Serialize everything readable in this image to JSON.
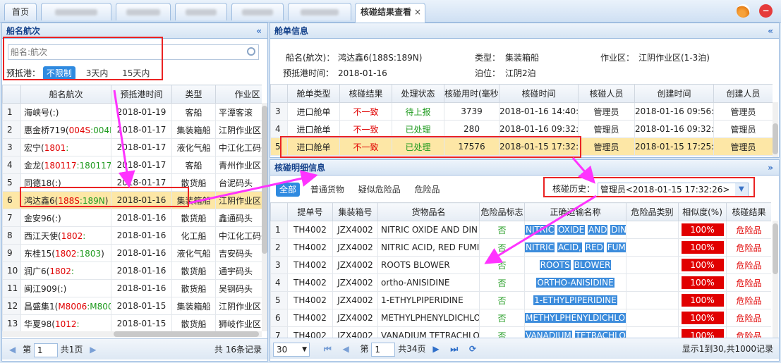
{
  "tabs": {
    "home": "首页",
    "result": "核碰结果查看",
    "close": "×"
  },
  "left": {
    "title": "船名航次",
    "collapse": "«",
    "search_placeholder": "船名:航次",
    "filter_label": "预抵港：",
    "filters": [
      "不限制",
      "3天内",
      "15天内"
    ],
    "headers": [
      "船名航次",
      "预抵港时间",
      "类型",
      "作业区"
    ],
    "rows": [
      {
        "n": "1",
        "name": "海峡号(:)",
        "date": "2018-01-19",
        "type": "客船",
        "zone": "平潭客滚"
      },
      {
        "n": "2",
        "name": "惠金桥719(",
        "r": "004S",
        "g": ":004N",
        "date": "2018-01-17",
        "type": "集装箱船",
        "zone": "江阴作业区("
      },
      {
        "n": "3",
        "name": "宏宁(",
        "r": "1801",
        "g": ":",
        "date": "2018-01-17",
        "type": "液化气船",
        "zone": "中江化工码头"
      },
      {
        "n": "4",
        "name": "金龙(",
        "r": "180117",
        "g": ":180117E",
        "date": "2018-01-17",
        "type": "客船",
        "zone": "青州作业区("
      },
      {
        "n": "5",
        "name": "同德18(:)",
        "date": "2018-01-17",
        "type": "散货船",
        "zone": "台泥码头"
      },
      {
        "n": "6",
        "name": "鸿达鑫6(",
        "r": "188S",
        "g": ":189N",
        "tail": ")",
        "date": "2018-01-16",
        "type": "集装箱船",
        "zone": "江阴作业区("
      },
      {
        "n": "7",
        "name": "金安96(:)",
        "date": "2018-01-16",
        "type": "散货船",
        "zone": "鑫通码头"
      },
      {
        "n": "8",
        "name": "西江天使(",
        "r": "1802",
        "g": ":",
        "date": "2018-01-16",
        "type": "化工船",
        "zone": "中江化工码头"
      },
      {
        "n": "9",
        "name": "东桂15(",
        "r": "1802",
        "g": ":1803",
        "tail": ")",
        "date": "2018-01-16",
        "type": "液化气船",
        "zone": "吉安码头"
      },
      {
        "n": "10",
        "name": "润广6(",
        "r": "1802",
        "g": ":",
        "date": "2018-01-16",
        "type": "散货船",
        "zone": "通宇码头"
      },
      {
        "n": "11",
        "name": "闽江909(:)",
        "date": "2018-01-16",
        "type": "散货船",
        "zone": "吴钢码头"
      },
      {
        "n": "12",
        "name": "昌盛集1(",
        "r": "M8006",
        "g": ":M800",
        "date": "2018-01-15",
        "type": "集装箱船",
        "zone": "江阴作业区("
      },
      {
        "n": "13",
        "name": "华夏98(",
        "r": "1012",
        "g": ":",
        "date": "2018-01-15",
        "type": "散货船",
        "zone": "狮岐作业区("
      }
    ],
    "pager": {
      "page_label": "第",
      "page": "1",
      "total_pages": "共1页",
      "total": "共 16条记录"
    }
  },
  "manifest": {
    "title": "舱单信息",
    "collapse": "«",
    "ship_label": "船名(航次)：",
    "ship": "鸿达鑫6(188S:189N)",
    "type_label": "类型：",
    "type": "集装箱船",
    "zone_label": "作业区：",
    "zone": "江阴作业区(1-3泊)",
    "eta_label": "预抵港时间：",
    "eta": "2018-01-16",
    "berth_label": "泊位：",
    "berth": "江阴2泊",
    "headers": [
      "舱单类型",
      "核碰结果",
      "处理状态",
      "核碰用时(毫秒)",
      "核碰时间",
      "核碰人员",
      "创建时间",
      "创建人员"
    ],
    "rows": [
      {
        "n": "3",
        "t": "进口舱单",
        "res": "不一致",
        "st": "待上报",
        "ms": "3739",
        "time": "2018-01-16 14:40:35",
        "who": "管理员",
        "ct": "2018-01-16 09:56:30",
        "cw": "管理员"
      },
      {
        "n": "4",
        "t": "进口舱单",
        "res": "不一致",
        "st": "已处理",
        "ms": "280",
        "time": "2018-01-16 09:32:05",
        "who": "管理员",
        "ct": "2018-01-16 09:32:01",
        "cw": "管理员"
      },
      {
        "n": "5",
        "t": "进口舱单",
        "res": "不一致",
        "st": "已处理",
        "ms": "17576",
        "time": "2018-01-15 17:32:26",
        "who": "管理员",
        "ct": "2018-01-15 17:25:35",
        "cw": "管理员"
      }
    ]
  },
  "detail": {
    "title": "核碰明细信息",
    "collapse": "»",
    "filters": [
      "全部",
      "普通货物",
      "疑似危险品",
      "危险品"
    ],
    "history_label": "核碰历史：",
    "history_value": "管理员<2018-01-15 17:32:26>",
    "headers": [
      "提单号",
      "集装箱号",
      "货物品名",
      "危险品标志",
      "正确运输名称",
      "危险品类别",
      "相似度(%)",
      "核碰结果"
    ],
    "rows": [
      {
        "n": "1",
        "bl": "TH4002",
        "ctn": "JZX4002",
        "name": "NITRIC OXIDE AND DIN",
        "flag": "否",
        "words": [
          "NITRIC",
          "OXIDE",
          "AND",
          "DIN"
        ],
        "pct": "100%",
        "res": "危险品"
      },
      {
        "n": "2",
        "bl": "TH4002",
        "ctn": "JZX4002",
        "name": "NITRIC ACID, RED FUMI",
        "flag": "否",
        "words": [
          "NITRIC",
          "ACID,",
          "RED",
          "FUMI"
        ],
        "pct": "100%",
        "res": "危险品"
      },
      {
        "n": "3",
        "bl": "TH4002",
        "ctn": "JZX4002",
        "name": "ROOTS BLOWER",
        "flag": "否",
        "words": [
          "ROOTS",
          "BLOWER"
        ],
        "pct": "100%",
        "res": "危险品"
      },
      {
        "n": "4",
        "bl": "TH4002",
        "ctn": "JZX4002",
        "name": "ortho-ANISIDINE",
        "flag": "否",
        "words": [
          "ORTHO-ANISIDINE"
        ],
        "pct": "100%",
        "res": "危险品"
      },
      {
        "n": "5",
        "bl": "TH4002",
        "ctn": "JZX4002",
        "name": "1-ETHYLPIPERIDINE",
        "flag": "否",
        "words": [
          "1-ETHYLPIPERIDINE"
        ],
        "pct": "100%",
        "res": "危险品"
      },
      {
        "n": "6",
        "bl": "TH4002",
        "ctn": "JZX4002",
        "name": "METHYLPHENYLDICHLO",
        "flag": "否",
        "words": [
          "METHYLPHENYLDICHLO"
        ],
        "pct": "100%",
        "res": "危险品"
      },
      {
        "n": "7",
        "bl": "TH4002",
        "ctn": "JZX4002",
        "name": "VANADIUM TETRACHLO",
        "flag": "否",
        "words": [
          "VANADIUM",
          "TETRACHLO"
        ],
        "pct": "100%",
        "res": "危险品"
      }
    ],
    "pager": {
      "size": "30",
      "page_label": "第",
      "page": "1",
      "total_pages": "共34页",
      "total": "显示1到30,共1000记录"
    }
  }
}
